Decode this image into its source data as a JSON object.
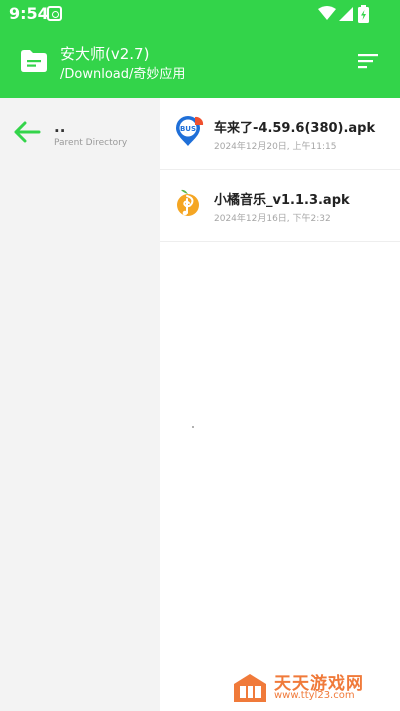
{
  "status_bar": {
    "time": "9:54"
  },
  "header": {
    "title": "安大师(v2.7)",
    "path": "/Download/奇妙应用",
    "accent_color": "#33d44a",
    "left_icon": "folder-icon",
    "right_icon": "sort-icon"
  },
  "sidebar": {
    "back_icon": "back-arrow-icon",
    "parent_symbol": "..",
    "parent_label": "Parent Directory"
  },
  "files": [
    {
      "name": "车来了-4.59.6(380).apk",
      "date": "2024年12月20日, 上午11:15",
      "icon": "bus-app-icon"
    },
    {
      "name": "小橘音乐_v1.1.3.apk",
      "date": "2024年12月16日, 下午2:32",
      "icon": "orange-music-app-icon"
    }
  ],
  "watermark": {
    "name": "天天游戏网",
    "url": "www.ttyl23.com"
  }
}
